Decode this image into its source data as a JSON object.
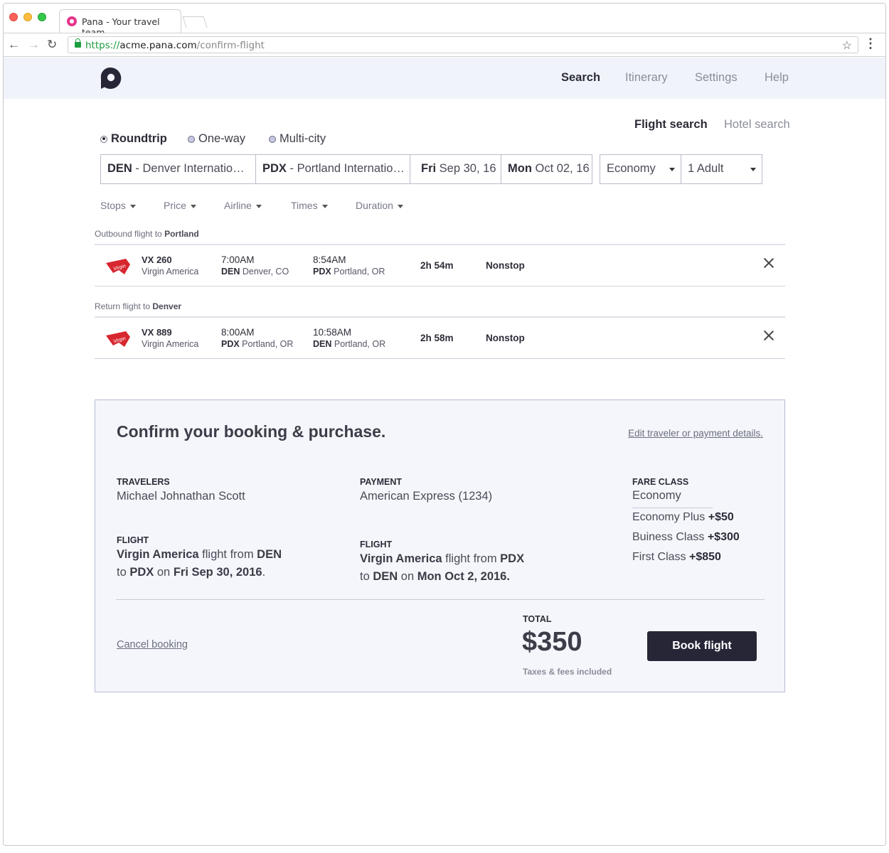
{
  "browser": {
    "tab_title": "Pana - Your travel team",
    "url_scheme": "https://",
    "url_host": "acme.pana.com",
    "url_path": "/confirm-flight"
  },
  "nav": {
    "search": "Search",
    "itinerary": "Itinerary",
    "settings": "Settings",
    "help": "Help"
  },
  "search_tabs": {
    "flight": "Flight search",
    "hotel": "Hotel search"
  },
  "trip_types": [
    "Roundtrip",
    "One-way",
    "Multi-city"
  ],
  "search_fields": {
    "origin_code": "DEN",
    "origin_name": " - Denver Internatio…",
    "dest_code": "PDX",
    "dest_name": " - Portland Internatio…",
    "depart_day": "Fri",
    "depart_date": " Sep 30, 16",
    "return_day": "Mon",
    "return_date": " Oct 02, 16",
    "cabin": "Economy",
    "passengers": "1 Adult"
  },
  "filters": [
    "Stops",
    "Price",
    "Airline",
    "Times",
    "Duration"
  ],
  "outbound": {
    "label_prefix": "Outbound flight to ",
    "label_city": "Portland",
    "flight_no": "VX 260",
    "airline": "Virgin America",
    "dep_time": "7:00AM",
    "dep_code": "DEN",
    "dep_city": " Denver, CO",
    "arr_time": "8:54AM",
    "arr_code": "PDX",
    "arr_city": " Portland, OR",
    "duration": "2h 54m",
    "stops": "Nonstop"
  },
  "return": {
    "label_prefix": "Return flight to ",
    "label_city": "Denver",
    "flight_no": "VX 889",
    "airline": "Virgin America",
    "dep_time": "8:00AM",
    "dep_code": "PDX",
    "dep_city": " Portland, OR",
    "arr_time": "10:58AM",
    "arr_code": "DEN",
    "arr_city": " Portland, OR",
    "duration": "2h 58m",
    "stops": "Nonstop"
  },
  "confirm": {
    "title": "Confirm your booking & purchase.",
    "edit_link": "Edit traveler or payment details.",
    "travelers_label": "TRAVELERS",
    "traveler_name": "Michael Johnathan Scott",
    "payment_label": "PAYMENT",
    "payment_value": "American Express (1234)",
    "fare_label": "FARE CLASS",
    "fare_selected": "Economy",
    "fare_options": [
      {
        "name": "Economy Plus ",
        "price": "+$50"
      },
      {
        "name": "Buiness Class ",
        "price": "+$300"
      },
      {
        "name": "First Class ",
        "price": "+$850"
      }
    ],
    "flight1_label": "FLIGHT",
    "flight1_airline": "Virgin America",
    "flight1_from_text": " flight from ",
    "flight1_from": "DEN",
    "flight1_to_text": "to ",
    "flight1_to": "PDX",
    "flight1_on_text": " on ",
    "flight1_date": "Fri Sep 30, 2016",
    "flight1_end": ".",
    "flight2_label": "FLIGHT",
    "flight2_airline": "Virgin America",
    "flight2_from_text": " flight from ",
    "flight2_from": "PDX",
    "flight2_to_text": "to ",
    "flight2_to": "DEN",
    "flight2_on_text": " on ",
    "flight2_date": "Mon Oct 2, 2016.",
    "cancel": "Cancel booking",
    "total_label": "TOTAL",
    "total_value": "$350",
    "tax_note": "Taxes & fees included",
    "book_button": "Book flight"
  },
  "colors": {
    "header_bg": "#f0f3fa",
    "brand_dark": "#262637",
    "favicon": "#e6348b",
    "airline_red": "#d7262f"
  }
}
